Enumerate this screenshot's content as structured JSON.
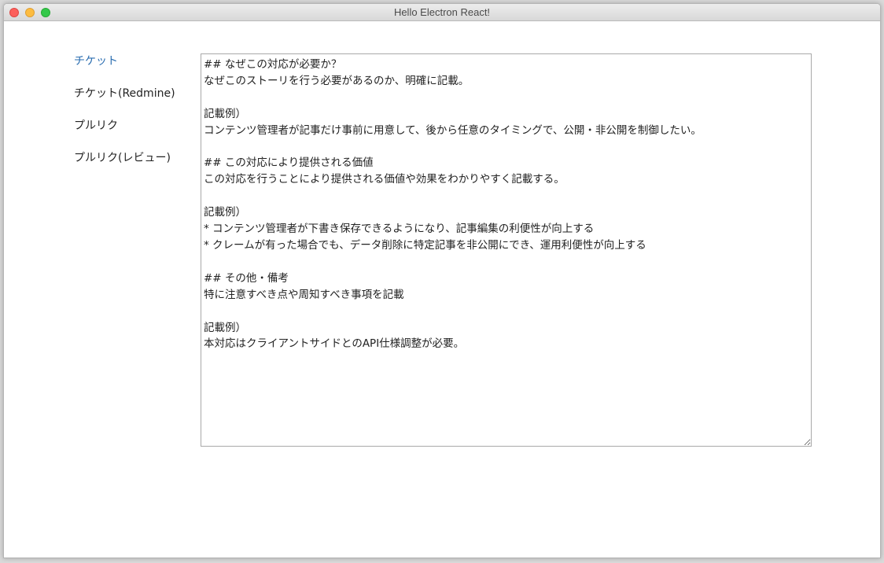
{
  "window": {
    "title": "Hello Electron React!"
  },
  "sidebar": {
    "items": [
      {
        "label": "チケット",
        "active": true
      },
      {
        "label": "チケット(Redmine)",
        "active": false
      },
      {
        "label": "プルリク",
        "active": false
      },
      {
        "label": "プルリク(レビュー)",
        "active": false
      }
    ]
  },
  "editor": {
    "value": "## なぜこの対応が必要か？\nなぜこのストーリを行う必要があるのか、明確に記載。\n\n記載例）\nコンテンツ管理者が記事だけ事前に用意して、後から任意のタイミングで、公開・非公開を制御したい。\n\n## この対応により提供される価値\nこの対応を行うことにより提供される価値や効果をわかりやすく記載する。\n\n記載例）\n* コンテンツ管理者が下書き保存できるようになり、記事編集の利便性が向上する\n* クレームが有った場合でも、データ削除に特定記事を非公開にでき、運用利便性が向上する\n\n## その他・備考\n特に注意すべき点や周知すべき事項を記載\n\n記載例）\n本対応はクライアントサイドとのAPI仕様調整が必要。"
  },
  "colors": {
    "active_link": "#2a6db0",
    "text": "#222222",
    "close": "#fc605c",
    "minimize": "#fdbc40",
    "maximize": "#34c84a"
  }
}
